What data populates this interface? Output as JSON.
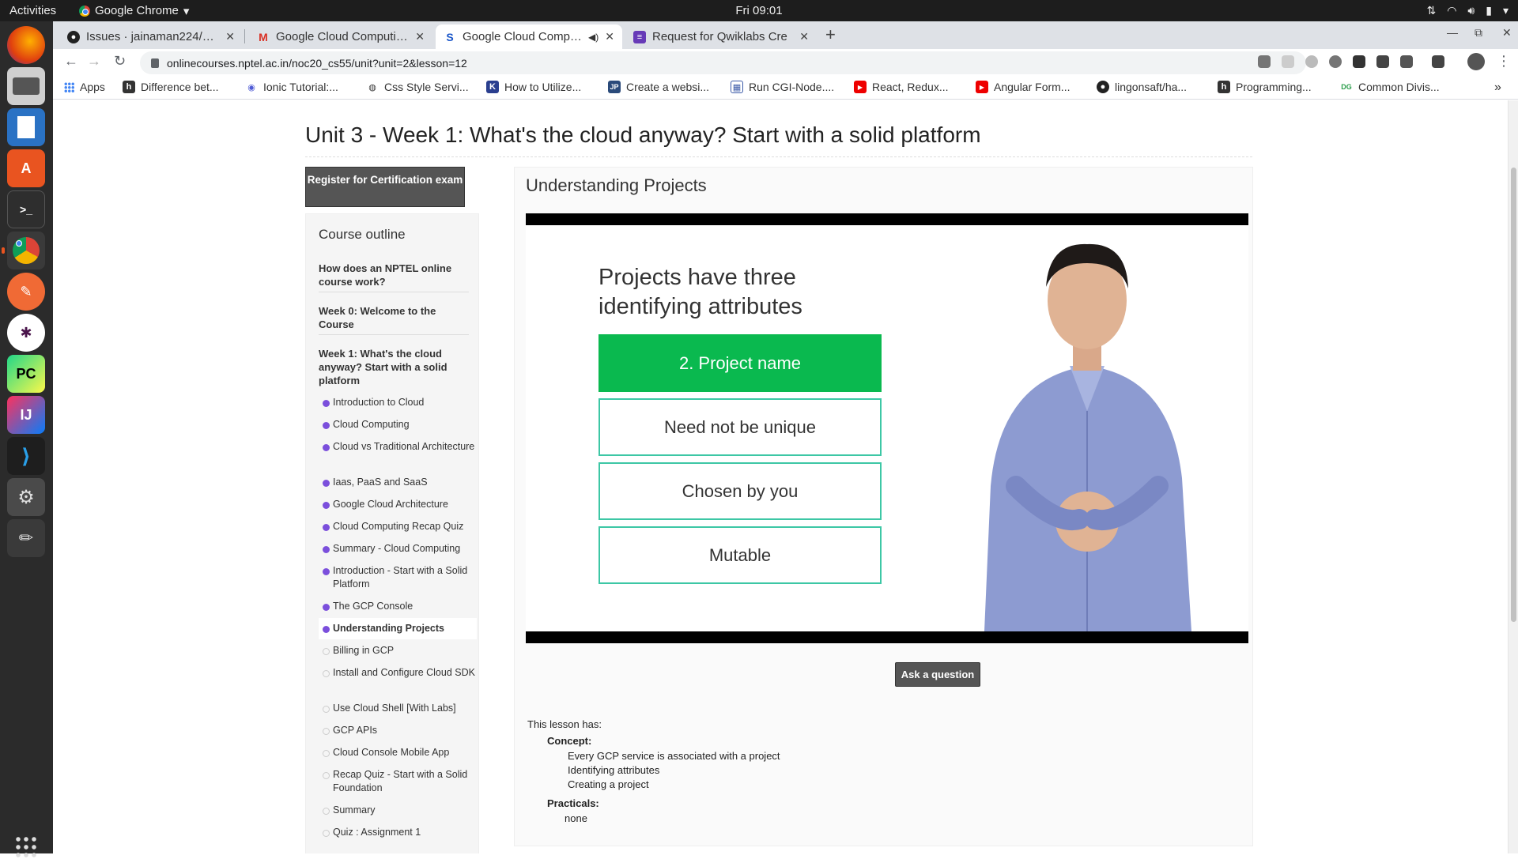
{
  "system": {
    "activities": "Activities",
    "app_name": "Google Chrome",
    "clock": "Fri 09:01"
  },
  "tabs": [
    {
      "title": "Issues · jainaman224/Algo",
      "icon": "github-icon"
    },
    {
      "title": "Google Cloud Computing",
      "icon": "gmail-icon"
    },
    {
      "title": "Google Cloud Computin",
      "icon": "swayam-icon"
    },
    {
      "title": "Request for Qwiklabs Cre",
      "icon": "forms-icon"
    }
  ],
  "address_bar": {
    "url": "onlinecourses.nptel.ac.in/noc20_cs55/unit?unit=2&lesson=12"
  },
  "bookmarks": [
    {
      "label": "Apps"
    },
    {
      "label": "Difference bet..."
    },
    {
      "label": "Ionic Tutorial:..."
    },
    {
      "label": "Css Style Servi..."
    },
    {
      "label": "How to Utilize..."
    },
    {
      "label": "Create a websi..."
    },
    {
      "label": "Run CGI-Node...."
    },
    {
      "label": "React, Redux..."
    },
    {
      "label": "Angular Form..."
    },
    {
      "label": "lingonsaft/ha..."
    },
    {
      "label": "Programming..."
    },
    {
      "label": "Common Divis..."
    }
  ],
  "page": {
    "unit_title": "Unit 3 - Week 1: What's the cloud anyway? Start with a solid platform",
    "cert_button": "Register for Certification exam",
    "outline_title": "Course outline",
    "weeks": [
      "How does an NPTEL online course work?",
      "Week 0: Welcome to the Course",
      "Week 1: What's the cloud anyway? Start with a solid platform"
    ],
    "lessons": [
      {
        "label": "Introduction to Cloud",
        "done": true
      },
      {
        "label": "Cloud Computing",
        "done": true
      },
      {
        "label": "Cloud vs Traditional Architecture",
        "done": true
      },
      {
        "label": "Iaas, PaaS and SaaS",
        "done": true
      },
      {
        "label": "Google Cloud Architecture",
        "done": true
      },
      {
        "label": "Cloud Computing Recap Quiz",
        "done": true
      },
      {
        "label": "Summary - Cloud Computing",
        "done": true
      },
      {
        "label": "Introduction - Start with a Solid Platform",
        "done": true
      },
      {
        "label": "The GCP Console",
        "done": true
      },
      {
        "label": "Understanding Projects",
        "done": true,
        "current": true
      },
      {
        "label": "Billing in GCP",
        "done": false
      },
      {
        "label": "Install and Configure Cloud SDK",
        "done": false
      },
      {
        "label": "Use Cloud Shell [With Labs]",
        "done": false
      },
      {
        "label": "GCP APIs",
        "done": false
      },
      {
        "label": "Cloud Console Mobile App",
        "done": false
      },
      {
        "label": "Recap Quiz - Start with a Solid Foundation",
        "done": false
      },
      {
        "label": "Summary",
        "done": false
      },
      {
        "label": "Quiz : Assignment 1",
        "done": false
      }
    ],
    "lesson_title": "Understanding Projects",
    "video": {
      "slide_title": "Projects have three identifying attributes",
      "boxes": [
        "2. Project name",
        "Need not be unique",
        "Chosen by you",
        "Mutable"
      ]
    },
    "ask_button": "Ask a question",
    "lesson_has": "This lesson has:",
    "concept_label": "Concept:",
    "concepts": [
      "Every GCP service is associated with a project",
      "Identifying attributes",
      "Creating a project"
    ],
    "practicals_label": "Practicals:",
    "practicals": "none"
  },
  "colors": {
    "accent_green": "#0ab94f",
    "dot_purple": "#7b4fdc",
    "button_gray": "#555555"
  }
}
